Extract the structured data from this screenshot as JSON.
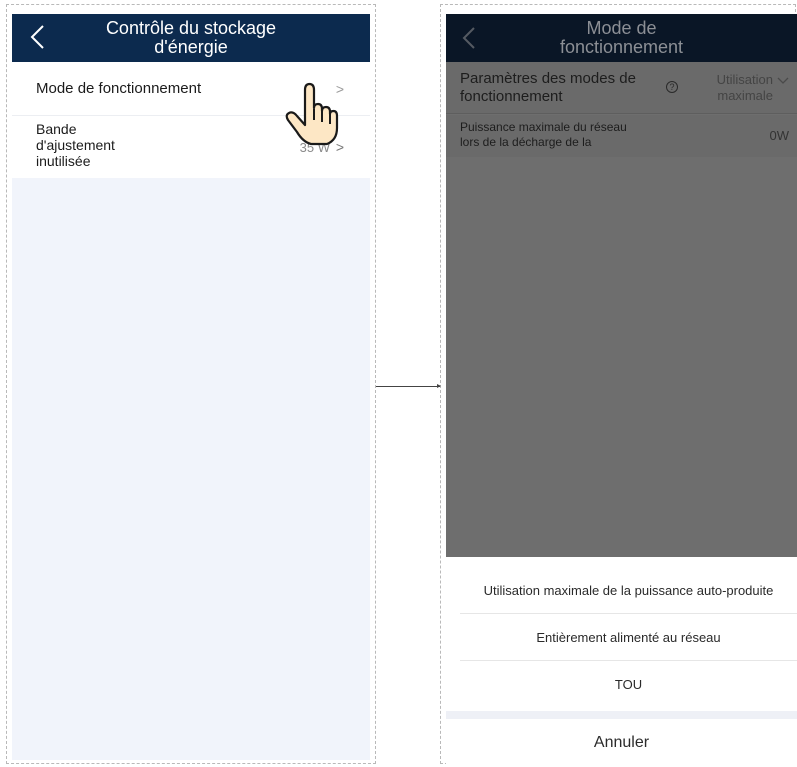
{
  "left_screen": {
    "title_line1": "Contrôle du stockage",
    "title_line2": "d'énergie",
    "rows": [
      {
        "label": "Mode de fonctionnement",
        "value": "",
        "chevron": ">"
      },
      {
        "label_line1": "Bande",
        "label_line2": "d'ajustement",
        "label_line3": "inutilisée",
        "value": "35 W",
        "chevron": ">"
      }
    ]
  },
  "right_screen": {
    "title_line1": "Mode de",
    "title_line2": "fonctionnement",
    "mode_row": {
      "label_line1": "Paramètres des modes de",
      "label_line2": "fonctionnement",
      "help": "?",
      "value_line1": "Utilisation",
      "value_line2": "maximale"
    },
    "grid_row": {
      "label_line1": "Puissance maximale du réseau",
      "label_line2": "lors de la décharge de la",
      "value": "0W"
    },
    "sheet": {
      "options": [
        "Utilisation maximale de la puissance auto-produite",
        "Entièrement alimenté au réseau",
        "TOU"
      ],
      "cancel": "Annuler"
    }
  },
  "icons": {
    "back": "chevron-left-icon",
    "chevron": "chevron-right-icon",
    "dropdown": "chevron-down-icon",
    "pointer": "pointing-hand-icon"
  },
  "colors": {
    "header_left": "#0c2a4e",
    "header_right": "#0a1626",
    "overlay": "#6e6e6e",
    "list_bg": "#f1f4fb"
  }
}
